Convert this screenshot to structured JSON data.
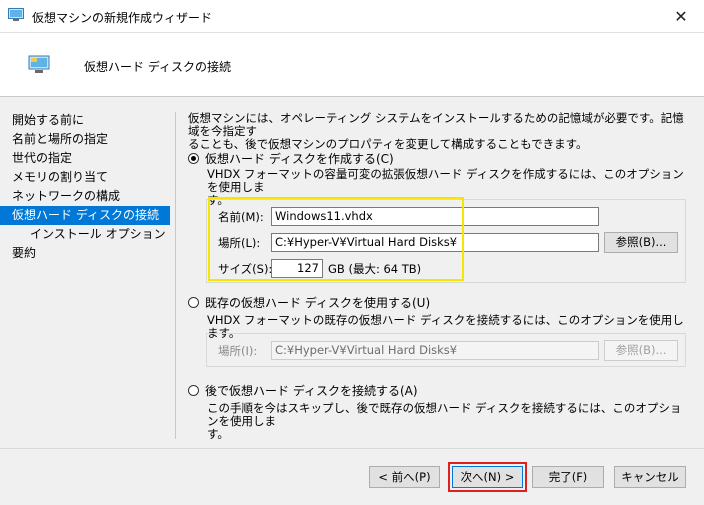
{
  "window": {
    "title": "仮想マシンの新規作成ウィザード",
    "close_glyph": "✕"
  },
  "header": {
    "title": "仮想ハード ディスクの接続"
  },
  "nav": {
    "items": [
      {
        "label": "開始する前に"
      },
      {
        "label": "名前と場所の指定"
      },
      {
        "label": "世代の指定"
      },
      {
        "label": "メモリの割り当て"
      },
      {
        "label": "ネットワークの構成"
      },
      {
        "label": "仮想ハード ディスクの接続"
      },
      {
        "label": "インストール オプション"
      },
      {
        "label": "要約"
      }
    ],
    "selected_index": 5
  },
  "intro": {
    "line1": "仮想マシンには、オペレーティング システムをインストールするための記憶域が必要です。記憶域を今指定す",
    "line2": "ることも、後で仮想マシンのプロパティを変更して構成することもできます。"
  },
  "option_create": {
    "label": "仮想ハード ディスクを作成する(C)",
    "selected": true,
    "desc_line1": "VHDX フォーマットの容量可変の拡張仮想ハード ディスクを作成するには、このオプションを使用しま",
    "desc_line2": "す。",
    "name_label": "名前(M):",
    "name_value": "Windows11.vhdx",
    "location_label": "場所(L):",
    "location_value": "C:¥Hyper-V¥Virtual Hard Disks¥",
    "browse_label": "参照(B)...",
    "size_label": "サイズ(S):",
    "size_value": "127",
    "size_unit": "GB (最大: 64 TB)"
  },
  "option_existing": {
    "label": "既存の仮想ハード ディスクを使用する(U)",
    "selected": false,
    "desc": "VHDX フォーマットの既存の仮想ハード ディスクを接続するには、このオプションを使用します。",
    "location_label": "場所(I):",
    "location_value": "C:¥Hyper-V¥Virtual Hard Disks¥",
    "browse_label": "参照(B)..."
  },
  "option_later": {
    "label": "後で仮想ハード ディスクを接続する(A)",
    "selected": false,
    "desc_line1": "この手順を今はスキップし、後で既存の仮想ハード ディスクを接続するには、このオプションを使用しま",
    "desc_line2": "す。"
  },
  "footer": {
    "back_label": "< 前へ(P)",
    "next_label": "次へ(N) >",
    "finish_label": "完了(F)",
    "cancel_label": "キャンセル"
  },
  "colors": {
    "selection": "#0078d7",
    "highlight_yellow": "#f5e600",
    "highlight_red": "#e0201e"
  }
}
